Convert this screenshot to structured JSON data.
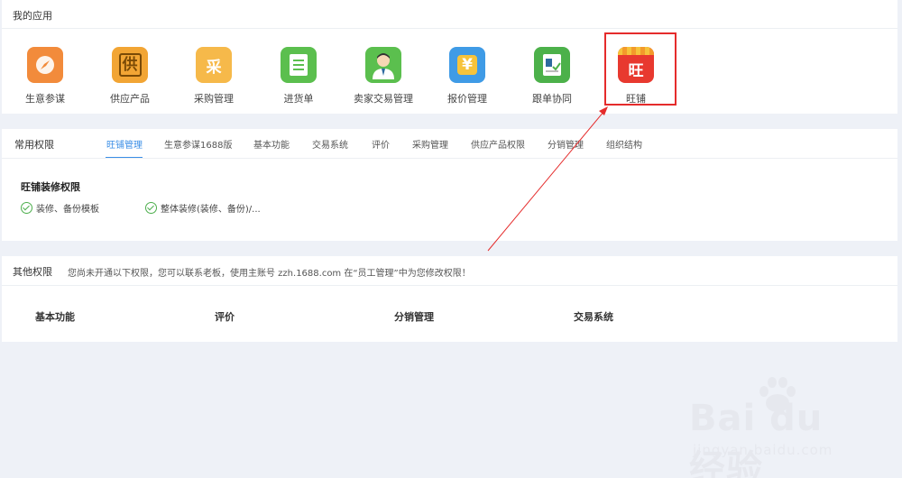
{
  "apps_panel": {
    "title": "我的应用",
    "apps": [
      {
        "label": "生意参谋",
        "glyph": "",
        "color": "#f28b3b"
      },
      {
        "label": "供应产品",
        "glyph": "供",
        "color": "#f2a534"
      },
      {
        "label": "采购管理",
        "glyph": "采",
        "color": "#f6b94a"
      },
      {
        "label": "进货单",
        "glyph": "",
        "color": "#5bbf4e"
      },
      {
        "label": "卖家交易管理",
        "glyph": "",
        "color": "#5bbf4e"
      },
      {
        "label": "报价管理",
        "glyph": "¥",
        "color": "#3f9be6"
      },
      {
        "label": "跟单协同",
        "glyph": "",
        "color": "#4cb14a"
      },
      {
        "label": "旺铺",
        "glyph": "旺",
        "color": "#e8392f"
      }
    ]
  },
  "perm_panel": {
    "label": "常用权限",
    "tabs": [
      "旺铺管理",
      "生意参谋1688版",
      "基本功能",
      "交易系统",
      "评价",
      "采购管理",
      "供应产品权限",
      "分销管理",
      "组织结构"
    ],
    "section_title": "旺铺装修权限",
    "items": [
      "装修、备份模板",
      "整体装修(装修、备份)/..."
    ]
  },
  "other_panel": {
    "title": "其他权限",
    "note": "您尚未开通以下权限，您可以联系老板，使用主账号 zzh.1688.com 在“员工管理”中为您修改权限！",
    "columns": [
      "基本功能",
      "评价",
      "分销管理",
      "交易系统"
    ]
  },
  "watermark": {
    "logo": "Bai du 经验",
    "domain": "jingyan.baidu.com"
  },
  "colors": {
    "accent": "#3a8ee6",
    "highlight": "#e52b2b",
    "check": "#4cae4c"
  }
}
